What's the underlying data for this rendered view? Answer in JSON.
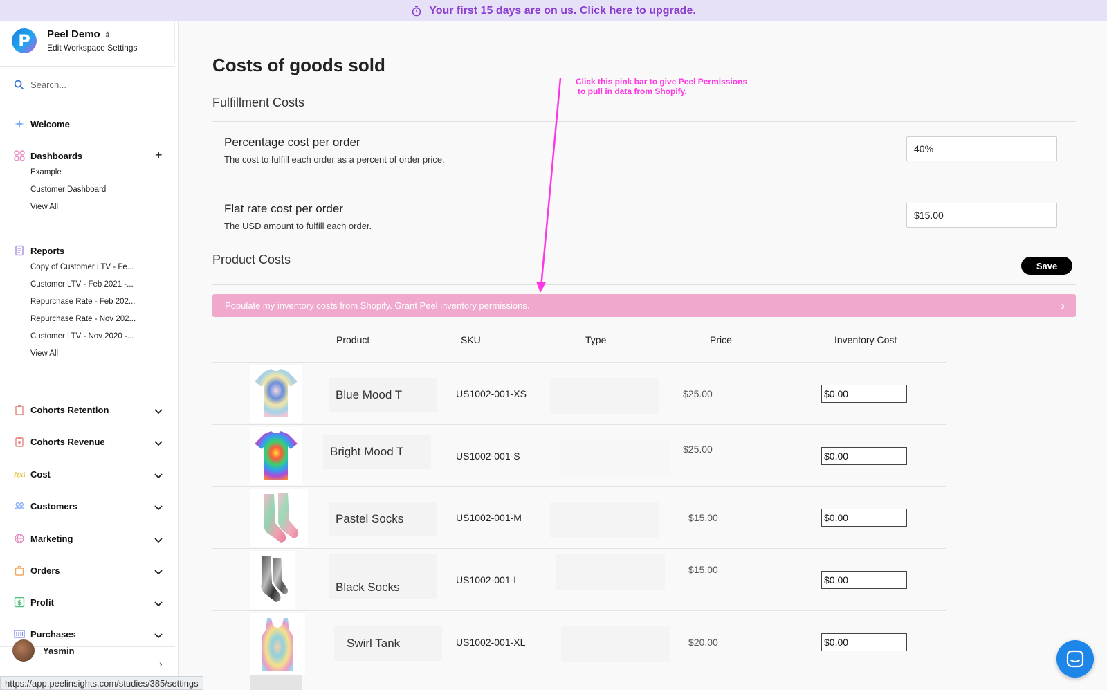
{
  "banner": {
    "text": "Your first 15 days are on us. Click here to upgrade.",
    "icon": "stopwatch-icon"
  },
  "workspace": {
    "name": "Peel Demo",
    "subtitle": "Edit Workspace Settings",
    "logo_letter": "P"
  },
  "search": {
    "placeholder": "Search..."
  },
  "nav": {
    "welcome": "Welcome",
    "dashboards": {
      "label": "Dashboards",
      "items": [
        "Example",
        "Customer Dashboard",
        "View All"
      ]
    },
    "reports": {
      "label": "Reports",
      "items": [
        "Copy of Customer LTV - Fe...",
        "Customer LTV - Feb 2021 -...",
        "Repurchase Rate - Feb 202...",
        "Repurchase Rate - Nov 202...",
        "Customer LTV - Nov 2020 -...",
        "View All"
      ]
    },
    "groups": [
      "Cohorts Retention",
      "Cohorts Revenue",
      "Cost",
      "Customers",
      "Marketing",
      "Orders",
      "Profit",
      "Purchases"
    ]
  },
  "user": {
    "name": "Yasmin"
  },
  "status_url": "https://app.peelinsights.com/studies/385/settings",
  "page": {
    "title": "Costs of goods sold",
    "fulfillment": {
      "title": "Fulfillment Costs",
      "percentage": {
        "label": "Percentage cost per order",
        "desc": "The cost to fulfill each order as a percent of order price.",
        "value": "40%"
      },
      "flat": {
        "label": "Flat rate cost per order",
        "desc": "The USD amount to fulfill each order.",
        "value": "$15.00"
      }
    },
    "product_costs": {
      "title": "Product Costs",
      "save_label": "Save",
      "pink_bar": "Populate my inventory costs from Shopify. Grant Peel inventory permissions.",
      "annotation_line1": "Click this pink bar to give Peel Permissions",
      "annotation_line2": "to pull in data from Shopify.",
      "annotation_color": "#ff36e6",
      "columns": [
        "Product",
        "SKU",
        "Type",
        "Price",
        "Inventory Cost"
      ],
      "rows": [
        {
          "product": "Blue Mood T",
          "sku": "US1002-001-XS",
          "type": "",
          "price": "$25.00",
          "inventory_cost": "$0.00"
        },
        {
          "product": "Bright Mood T",
          "sku": "US1002-001-S",
          "type": "",
          "price": "$25.00",
          "inventory_cost": "$0.00"
        },
        {
          "product": "Pastel Socks",
          "sku": "US1002-001-M",
          "type": "",
          "price": "$15.00",
          "inventory_cost": "$0.00"
        },
        {
          "product": "Black Socks",
          "sku": "US1002-001-L",
          "type": "",
          "price": "$15.00",
          "inventory_cost": "$0.00"
        },
        {
          "product": "Swirl Tank",
          "sku": "US1002-001-XL",
          "type": "",
          "price": "$20.00",
          "inventory_cost": "$0.00"
        }
      ]
    }
  },
  "colors": {
    "banner_bg": "#e7e1f7",
    "banner_text": "#8b3fd0",
    "pink_bar": "#f0a8cd",
    "chat": "#1e86e8"
  }
}
